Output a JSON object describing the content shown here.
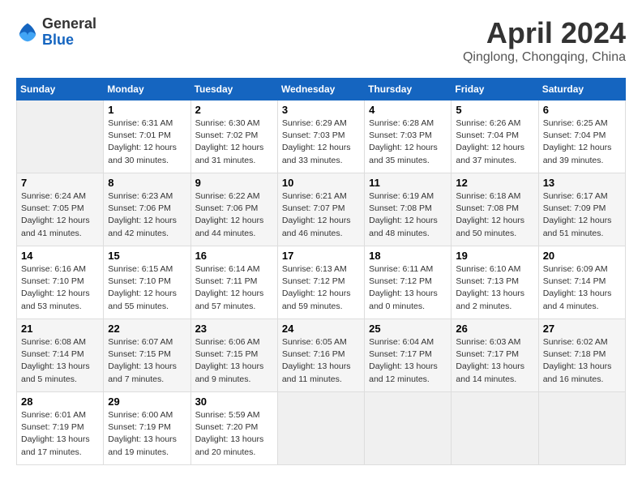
{
  "logo": {
    "general": "General",
    "blue": "Blue"
  },
  "title": {
    "month": "April 2024",
    "location": "Qinglong, Chongqing, China"
  },
  "days_of_week": [
    "Sunday",
    "Monday",
    "Tuesday",
    "Wednesday",
    "Thursday",
    "Friday",
    "Saturday"
  ],
  "weeks": [
    [
      {
        "day": "",
        "info": ""
      },
      {
        "day": "1",
        "info": "Sunrise: 6:31 AM\nSunset: 7:01 PM\nDaylight: 12 hours\nand 30 minutes."
      },
      {
        "day": "2",
        "info": "Sunrise: 6:30 AM\nSunset: 7:02 PM\nDaylight: 12 hours\nand 31 minutes."
      },
      {
        "day": "3",
        "info": "Sunrise: 6:29 AM\nSunset: 7:03 PM\nDaylight: 12 hours\nand 33 minutes."
      },
      {
        "day": "4",
        "info": "Sunrise: 6:28 AM\nSunset: 7:03 PM\nDaylight: 12 hours\nand 35 minutes."
      },
      {
        "day": "5",
        "info": "Sunrise: 6:26 AM\nSunset: 7:04 PM\nDaylight: 12 hours\nand 37 minutes."
      },
      {
        "day": "6",
        "info": "Sunrise: 6:25 AM\nSunset: 7:04 PM\nDaylight: 12 hours\nand 39 minutes."
      }
    ],
    [
      {
        "day": "7",
        "info": "Sunrise: 6:24 AM\nSunset: 7:05 PM\nDaylight: 12 hours\nand 41 minutes."
      },
      {
        "day": "8",
        "info": "Sunrise: 6:23 AM\nSunset: 7:06 PM\nDaylight: 12 hours\nand 42 minutes."
      },
      {
        "day": "9",
        "info": "Sunrise: 6:22 AM\nSunset: 7:06 PM\nDaylight: 12 hours\nand 44 minutes."
      },
      {
        "day": "10",
        "info": "Sunrise: 6:21 AM\nSunset: 7:07 PM\nDaylight: 12 hours\nand 46 minutes."
      },
      {
        "day": "11",
        "info": "Sunrise: 6:19 AM\nSunset: 7:08 PM\nDaylight: 12 hours\nand 48 minutes."
      },
      {
        "day": "12",
        "info": "Sunrise: 6:18 AM\nSunset: 7:08 PM\nDaylight: 12 hours\nand 50 minutes."
      },
      {
        "day": "13",
        "info": "Sunrise: 6:17 AM\nSunset: 7:09 PM\nDaylight: 12 hours\nand 51 minutes."
      }
    ],
    [
      {
        "day": "14",
        "info": "Sunrise: 6:16 AM\nSunset: 7:10 PM\nDaylight: 12 hours\nand 53 minutes."
      },
      {
        "day": "15",
        "info": "Sunrise: 6:15 AM\nSunset: 7:10 PM\nDaylight: 12 hours\nand 55 minutes."
      },
      {
        "day": "16",
        "info": "Sunrise: 6:14 AM\nSunset: 7:11 PM\nDaylight: 12 hours\nand 57 minutes."
      },
      {
        "day": "17",
        "info": "Sunrise: 6:13 AM\nSunset: 7:12 PM\nDaylight: 12 hours\nand 59 minutes."
      },
      {
        "day": "18",
        "info": "Sunrise: 6:11 AM\nSunset: 7:12 PM\nDaylight: 13 hours\nand 0 minutes."
      },
      {
        "day": "19",
        "info": "Sunrise: 6:10 AM\nSunset: 7:13 PM\nDaylight: 13 hours\nand 2 minutes."
      },
      {
        "day": "20",
        "info": "Sunrise: 6:09 AM\nSunset: 7:14 PM\nDaylight: 13 hours\nand 4 minutes."
      }
    ],
    [
      {
        "day": "21",
        "info": "Sunrise: 6:08 AM\nSunset: 7:14 PM\nDaylight: 13 hours\nand 5 minutes."
      },
      {
        "day": "22",
        "info": "Sunrise: 6:07 AM\nSunset: 7:15 PM\nDaylight: 13 hours\nand 7 minutes."
      },
      {
        "day": "23",
        "info": "Sunrise: 6:06 AM\nSunset: 7:15 PM\nDaylight: 13 hours\nand 9 minutes."
      },
      {
        "day": "24",
        "info": "Sunrise: 6:05 AM\nSunset: 7:16 PM\nDaylight: 13 hours\nand 11 minutes."
      },
      {
        "day": "25",
        "info": "Sunrise: 6:04 AM\nSunset: 7:17 PM\nDaylight: 13 hours\nand 12 minutes."
      },
      {
        "day": "26",
        "info": "Sunrise: 6:03 AM\nSunset: 7:17 PM\nDaylight: 13 hours\nand 14 minutes."
      },
      {
        "day": "27",
        "info": "Sunrise: 6:02 AM\nSunset: 7:18 PM\nDaylight: 13 hours\nand 16 minutes."
      }
    ],
    [
      {
        "day": "28",
        "info": "Sunrise: 6:01 AM\nSunset: 7:19 PM\nDaylight: 13 hours\nand 17 minutes."
      },
      {
        "day": "29",
        "info": "Sunrise: 6:00 AM\nSunset: 7:19 PM\nDaylight: 13 hours\nand 19 minutes."
      },
      {
        "day": "30",
        "info": "Sunrise: 5:59 AM\nSunset: 7:20 PM\nDaylight: 13 hours\nand 20 minutes."
      },
      {
        "day": "",
        "info": ""
      },
      {
        "day": "",
        "info": ""
      },
      {
        "day": "",
        "info": ""
      },
      {
        "day": "",
        "info": ""
      }
    ]
  ]
}
